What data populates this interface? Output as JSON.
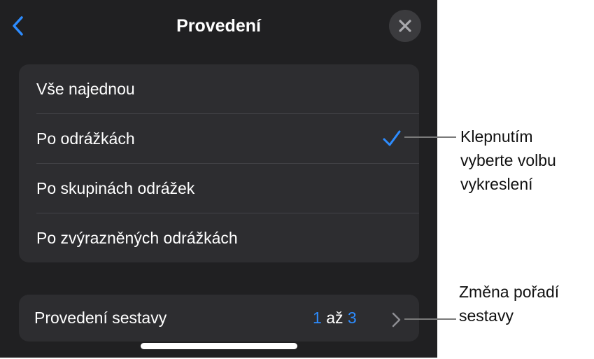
{
  "header": {
    "title": "Provedení",
    "back_icon": "chevron-left-icon",
    "close_icon": "close-icon"
  },
  "options": [
    {
      "label": "Vše najednou",
      "selected": false
    },
    {
      "label": "Po odrážkách",
      "selected": true
    },
    {
      "label": "Po skupinách odrážek",
      "selected": false
    },
    {
      "label": "Po zvýrazněných odrážkách",
      "selected": false
    }
  ],
  "order": {
    "label": "Provedení sestavy",
    "from": "1",
    "separator": "až",
    "to": "3"
  },
  "callouts": {
    "option": [
      "Klepnutím",
      "vyberte volbu",
      "vykreslení"
    ],
    "order": [
      "Změna pořadí",
      "sestavy"
    ]
  },
  "colors": {
    "panel_bg": "#202022",
    "group_bg": "#2d2d30",
    "accent": "#2d8cff"
  }
}
